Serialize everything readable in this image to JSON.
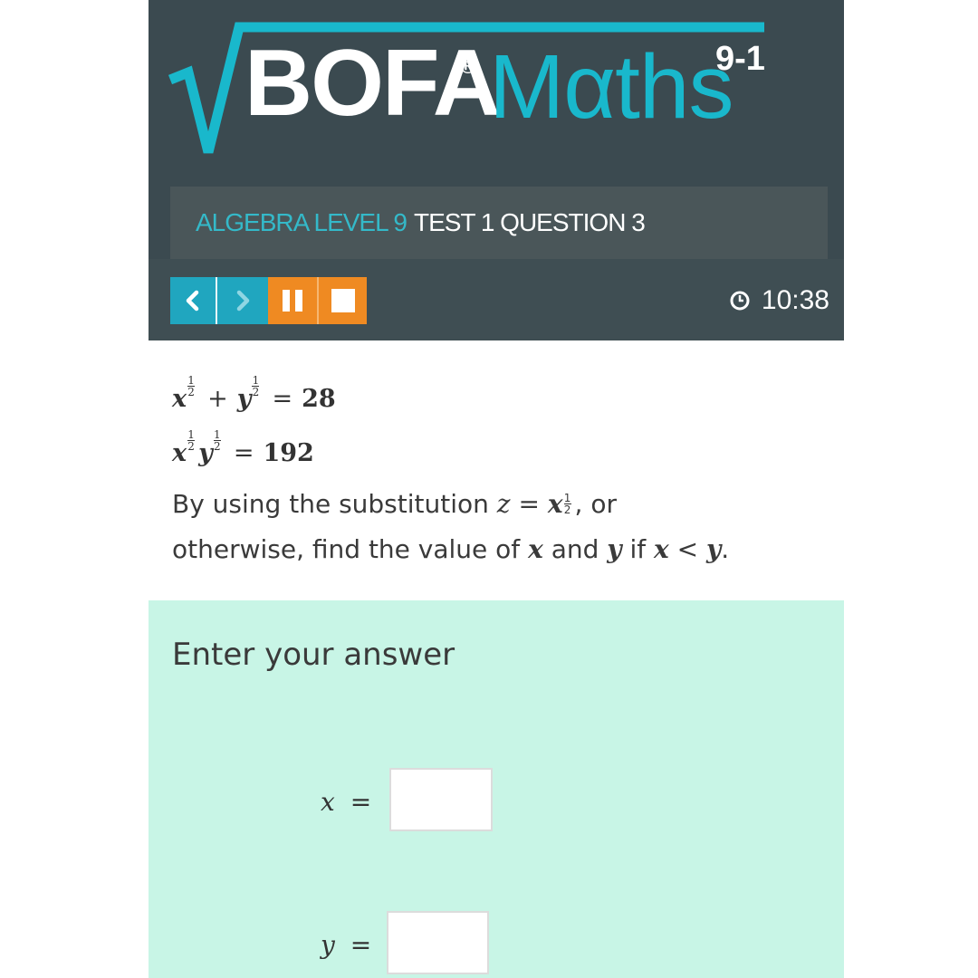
{
  "header": {
    "logo": {
      "brand_text": "BOFA",
      "registered_mark": "®",
      "product_text": "Mαths",
      "grade_range": "9-1"
    },
    "breadcrumb": {
      "topic": "ALGEBRA LEVEL 9",
      "current": "TEST 1 QUESTION 3"
    },
    "toolbar": {
      "timer": "10:38",
      "buttons": [
        {
          "icon": "chevron-left-icon"
        },
        {
          "icon": "chevron-right-icon"
        },
        {
          "icon": "pause-icon"
        },
        {
          "icon": "stop-icon"
        }
      ]
    }
  },
  "question": {
    "eq1": {
      "lhs_a": "x",
      "lhs_b": "y",
      "exp_num": "1",
      "exp_den": "2",
      "op": "+",
      "eq": "=",
      "rhs": "28"
    },
    "eq2": {
      "lhs_a": "x",
      "lhs_b": "y",
      "exp_num": "1",
      "exp_den": "2",
      "eq": "=",
      "rhs": "192"
    },
    "text_1": "By using the substitution",
    "sub_var": "z",
    "sub_eq": "=",
    "sub_base": "x",
    "text_2": ", or",
    "text_3": "otherwise, find the value of",
    "var_x": "x",
    "text_and": "and",
    "var_y": "y",
    "text_if": "if",
    "cond_lhs": "x",
    "cond_op": "<",
    "cond_rhs": "y",
    "text_end": "."
  },
  "answer": {
    "heading": "Enter your answer",
    "fields": [
      {
        "var": "x",
        "eq": "=",
        "value": ""
      },
      {
        "var": "y",
        "eq": "=",
        "value": ""
      }
    ]
  },
  "colors": {
    "header_bg": "#3b4a50",
    "accent_teal": "#19b8cc",
    "accent_orange": "#ef8a22",
    "answer_bg": "#c8f5e6"
  }
}
